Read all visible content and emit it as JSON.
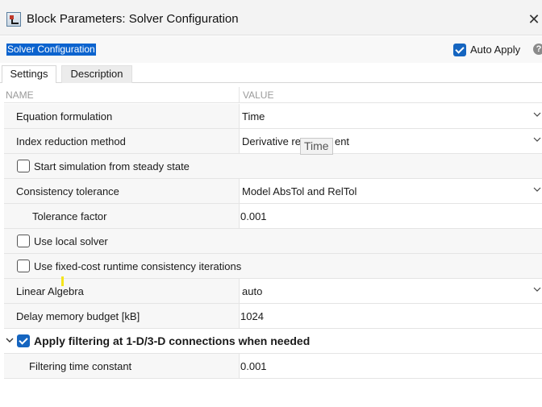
{
  "window": {
    "title": "Block Parameters: Solver Configuration",
    "block_name": "Solver Configuration",
    "auto_apply_label": "Auto Apply",
    "auto_apply_checked": true,
    "help_glyph": "?"
  },
  "tabs": [
    {
      "label": "Settings",
      "active": true
    },
    {
      "label": "Description",
      "active": false
    }
  ],
  "table": {
    "header_name": "NAME",
    "header_value": "VALUE",
    "rows": {
      "equation_formulation": {
        "label": "Equation formulation",
        "value": "Time"
      },
      "index_reduction": {
        "label": "Index reduction method",
        "value_left": "Derivative re",
        "value_right": "ent"
      },
      "steady_state": {
        "label": "Start simulation from steady state",
        "checked": false
      },
      "consistency_tolerance": {
        "label": "Consistency tolerance",
        "value": "Model AbsTol and RelTol"
      },
      "tolerance_factor": {
        "label": "Tolerance factor",
        "value": "0.001"
      },
      "local_solver": {
        "label": "Use local solver",
        "checked": false
      },
      "fixed_cost": {
        "label": "Use fixed-cost runtime consistency iterations",
        "checked": false
      },
      "linear_algebra": {
        "label": "Linear Algebra",
        "value": "auto"
      },
      "delay_memory": {
        "label": "Delay memory budget [kB]",
        "value": "1024"
      },
      "filtering": {
        "label": "Apply filtering at 1-D/3-D connections when needed",
        "checked": true
      },
      "filtering_time": {
        "label": "Filtering time constant",
        "value": "0.001"
      }
    }
  },
  "tooltip": {
    "text": "Time"
  },
  "icons": {
    "app": "block-parameters-icon",
    "close": "close-icon",
    "help": "help-icon",
    "dropdown": "chevron-down-icon",
    "collapse": "chevron-down-icon"
  },
  "colors": {
    "accent": "#1565c0",
    "selection": "#0b63ce",
    "marker": "#f5e51a"
  }
}
